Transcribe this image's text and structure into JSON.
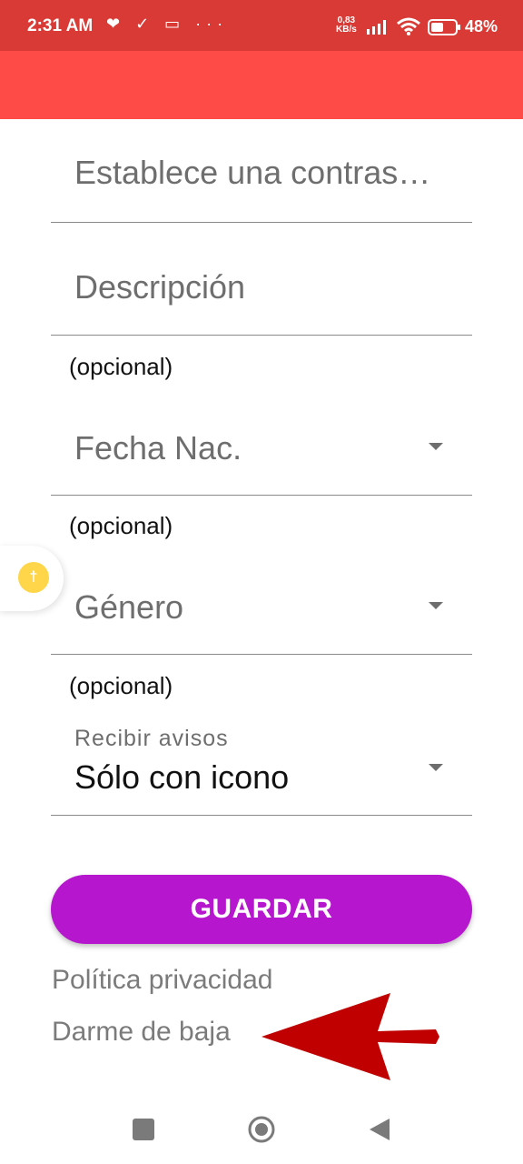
{
  "status_bar": {
    "time": "2:31 AM",
    "left_icons": "❤ ✓ ▭ ···",
    "net_speed_value": "0,83",
    "net_speed_unit": "KB/s",
    "battery": "48%"
  },
  "form": {
    "password_placeholder": "Establece una contraseña",
    "description_placeholder": "Descripción",
    "description_helper": "(opcional)",
    "birthdate_placeholder": "Fecha Nac.",
    "birthdate_helper": "(opcional)",
    "gender_placeholder": "Género",
    "gender_helper": "(opcional)",
    "notifications_label": "Recibir avisos",
    "notifications_value": "Sólo con icono"
  },
  "actions": {
    "save_label": "GUARDAR",
    "privacy_link": "Política privacidad",
    "unsubscribe_link": "Darme de baja"
  },
  "colors": {
    "status_bar": "#d93a35",
    "app_bar": "#ff4b47",
    "save_button": "#b617ce",
    "annotation_arrow": "#c00000"
  }
}
